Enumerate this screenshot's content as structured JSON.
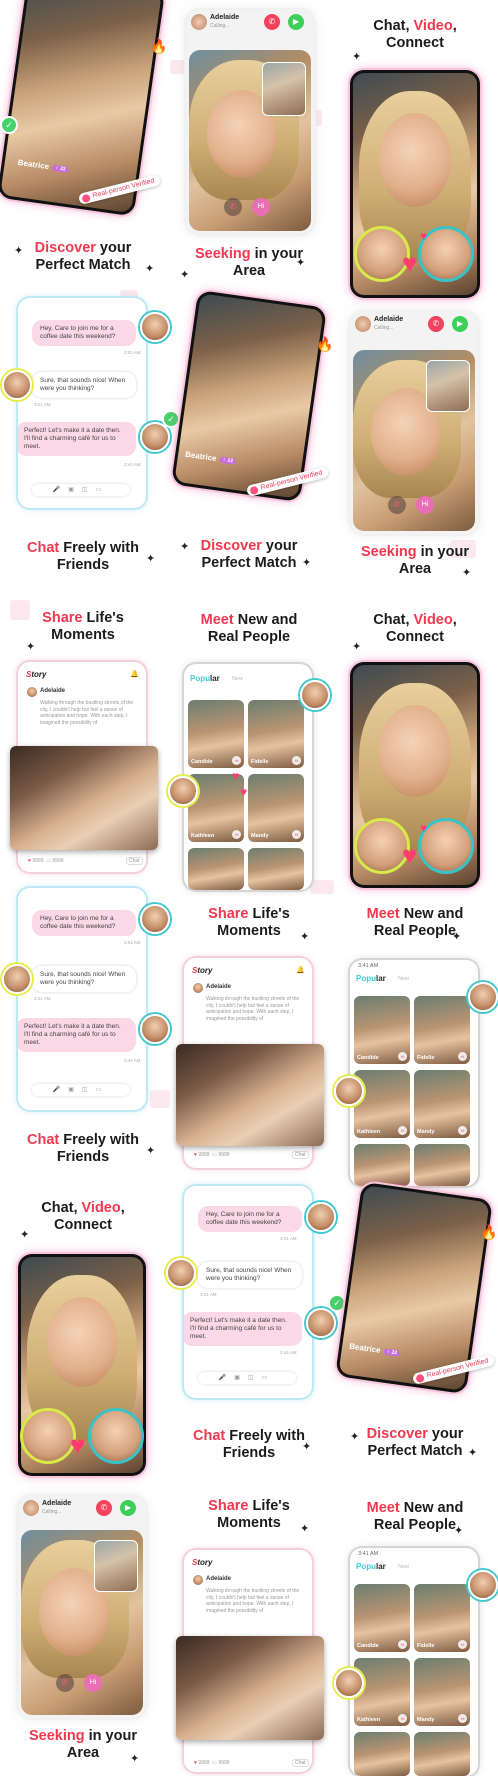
{
  "captions": {
    "discover": {
      "pre": "",
      "accent": "Discover",
      "rest": " your",
      "line2": "Perfect Match"
    },
    "seeking": {
      "accent": "Seeking",
      "rest": " in your",
      "line2": "Area"
    },
    "chat_video": {
      "pre": "Chat, ",
      "accent": "Video",
      "post": ",",
      "line2": "Connect"
    },
    "chat_friends": {
      "accent": "Chat",
      "rest": " Freely with",
      "line2": "Friends"
    },
    "share": {
      "accent": "Share",
      "rest": " Life's",
      "line2": "Moments"
    },
    "meet": {
      "accent": "Meet",
      "rest": " New and",
      "line2": "Real People"
    }
  },
  "profile": {
    "name": "Beatrice",
    "verified": "Real-person Verified"
  },
  "call": {
    "name": "Adelaide",
    "status": "Calling...",
    "hi": "Hi"
  },
  "chat": {
    "msg1": "Hey, Care to join me for a coffee date this weekend?",
    "time1": "3:01 AM",
    "msg2": "Sure, that sounds nice! When were you thinking?",
    "time2": "3:21 AM",
    "msg3": "Perfect! Let's make it a date then. I'll find a charming café for us to meet.",
    "time3": "3:44 AM"
  },
  "story": {
    "logo_a": "S",
    "logo_b": "tory",
    "author": "Adelaide",
    "text": "Walking through the bustling streets of the city, I couldn't help but feel a sense of anticipation and hope. With each step, I imagined the possibility of",
    "likes": "9999",
    "comments": "9999",
    "chat": "Chat"
  },
  "popular": {
    "title_a": "Popu",
    "title_b": "lar",
    "tab_new": "New",
    "time": "3:41 AM",
    "cards": [
      "Candide",
      "Fidelle",
      "Kathleen",
      "Mandy"
    ],
    "hi": "Hi"
  },
  "colors": {
    "accent_red": "#f2384e",
    "pink": "#fbd8e6",
    "teal": "#42c9d8",
    "green": "#3ccf59"
  }
}
